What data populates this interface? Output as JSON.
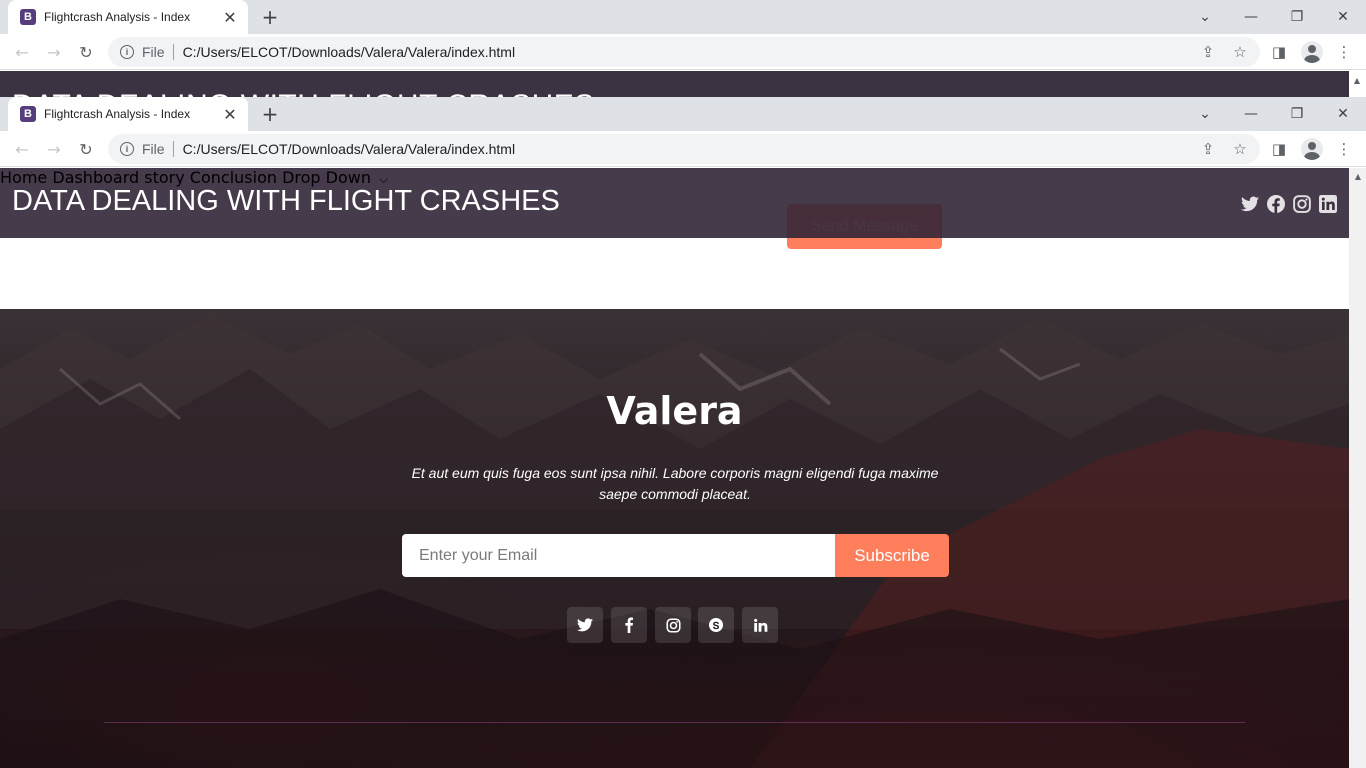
{
  "browser": {
    "tab_title": "Flightcrash Analysis - Index",
    "favicon_letter": "B",
    "address_prefix": "File",
    "url": "C:/Users/ELCOT/Downloads/Valera/Valera/index.html"
  },
  "back_page": {
    "ghost_title": "DATA DEALING WITH FLIGHT CRASHES"
  },
  "header": {
    "logo": "DATA DEALING WITH FLIGHT CRASHES",
    "nav": [
      "Home",
      "Dashboard",
      "story",
      "Conclusion",
      "Drop Down"
    ],
    "socials": [
      "twitter-icon",
      "facebook-icon",
      "instagram-icon",
      "linkedin-icon"
    ]
  },
  "contact": {
    "send_label": "Send Message"
  },
  "footer": {
    "brand": "Valera",
    "tagline_line1": "Et aut eum quis fuga eos sunt ipsa nihil. Labore corporis magni eligendi fuga maxime",
    "tagline_line2": "saepe commodi placeat.",
    "email_placeholder": "Enter your Email",
    "subscribe_label": "Subscribe",
    "socials": [
      "twitter-icon",
      "facebook-icon",
      "instagram-icon",
      "skype-icon",
      "linkedin-icon"
    ]
  },
  "colors": {
    "accent": "#ff7f5c",
    "header_bg": "#322636"
  }
}
